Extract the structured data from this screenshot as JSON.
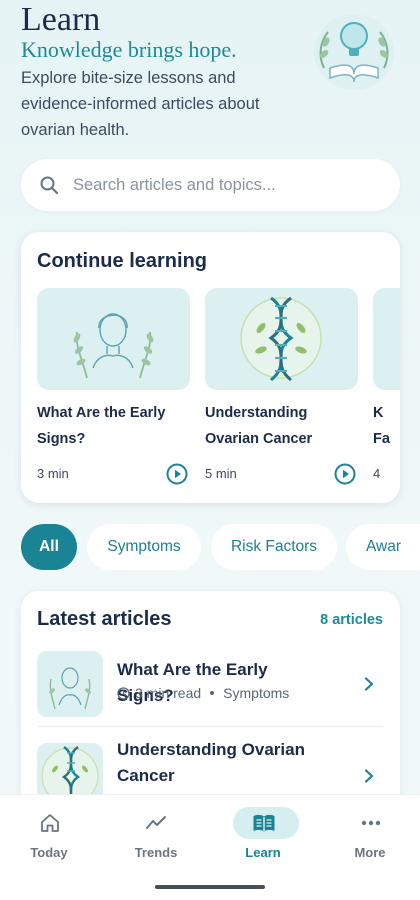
{
  "header": {
    "title": "Learn",
    "subtitle": "Knowledge brings hope.",
    "description": "Explore bite-size lessons and evidence-informed articles about ovarian health."
  },
  "search": {
    "placeholder": "Search articles and topics..."
  },
  "continue_learning": {
    "title": "Continue learning",
    "items": [
      {
        "title": "What Are the Early Signs?",
        "duration": "3 min",
        "icon": "woman-illustration-icon"
      },
      {
        "title": "Understanding Ovarian Cancer",
        "duration": "5 min",
        "icon": "dna-illustration-icon"
      },
      {
        "title": "K... Fa...",
        "title_visible": "K",
        "title_visible_2": "Fa",
        "duration": "4"
      }
    ]
  },
  "filters": {
    "selected": "All",
    "items": [
      "All",
      "Symptoms",
      "Risk Factors",
      "Awar"
    ]
  },
  "latest_articles": {
    "title": "Latest articles",
    "count": "8 articles",
    "items": [
      {
        "title": "What Are the Early Signs?",
        "read_time": "3 min read",
        "category": "Symptoms"
      },
      {
        "title": "Understanding Ovarian Cancer"
      }
    ]
  },
  "tabbar": {
    "active": "Learn",
    "items": [
      {
        "label": "Today",
        "icon": "home-icon"
      },
      {
        "label": "Trends",
        "icon": "trend-line-icon"
      },
      {
        "label": "Learn",
        "icon": "open-book-icon"
      },
      {
        "label": "More",
        "icon": "more-dots-icon"
      }
    ]
  },
  "colors": {
    "accent": "#1a8394",
    "navy": "#1d2b4a",
    "thumb_bg": "#dcf0f1"
  }
}
